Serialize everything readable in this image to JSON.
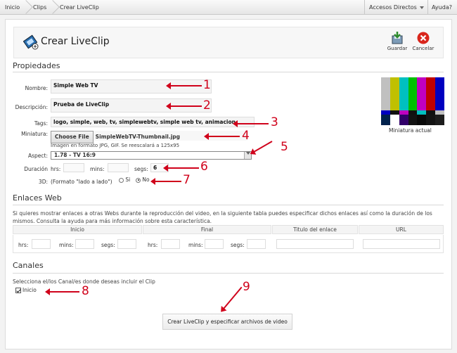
{
  "breadcrumb": [
    "Inicio",
    "Clips",
    "Crear LiveClip"
  ],
  "topbar": {
    "shortcuts": "Accesos Directos",
    "help": "Ayuda?"
  },
  "page": {
    "title": "Crear LiveClip",
    "save": "Guardar",
    "cancel": "Cancelar"
  },
  "props": {
    "heading": "Propiedades",
    "name_label": "Nombre:",
    "name_value": "Simple Web TV",
    "desc_label": "Descripción:",
    "desc_value": "Prueba de LiveClip",
    "tags_label": "Tags:",
    "tags_value": "logo, simple, web, tv, simplewebtv, simple web tv, animacion",
    "thumb_label": "Miniatura:",
    "choose_file": "Choose File",
    "file_name": "SimpleWebTV-Thumbnail.jpg",
    "thumb_hint": "Imagen en formato JPG, GIF. Se reescalará a 125x95",
    "aspect_label": "Aspect:",
    "aspect_value": "1.78 - TV 16:9",
    "duration_label": "Duración",
    "hrs": "hrs:",
    "mins": "mins:",
    "segs": "segs:",
    "segs_value": "6",
    "three_d_label": "3D:",
    "three_d_hint": "(Formato \"lado a lado\")",
    "si": "Si",
    "no": "No",
    "thumb_caption": "Miniatura actual"
  },
  "links": {
    "heading": "Enlaces Web",
    "desc": "Si quieres mostrar enlaces a otras Webs durante la reproducción del video, en la siguiente tabla puedes especificar dichos enlaces así como la duración de los mismos. Consulta la ayuda para más información sobre esta característica.",
    "col_start": "Inicio",
    "col_end": "Final",
    "col_title": "Titulo del enlace",
    "col_url": "URL",
    "hrs": "hrs:",
    "mins": "mins:",
    "segs": "segs:"
  },
  "channels": {
    "heading": "Canales",
    "desc": "Selecciona el/los Canal/es donde deseas incluir el Clip",
    "item": "Inicio",
    "submit": "Crear LiveClip y especificar archivos de video"
  },
  "callouts": [
    "1",
    "2",
    "3",
    "4",
    "5",
    "6",
    "7",
    "8",
    "9"
  ],
  "colors": {
    "callout": "#d0021b",
    "bars_top": [
      "#c0c0c0",
      "#c0c000",
      "#00c0c0",
      "#00c000",
      "#c000c0",
      "#c00000",
      "#0000c0"
    ]
  }
}
